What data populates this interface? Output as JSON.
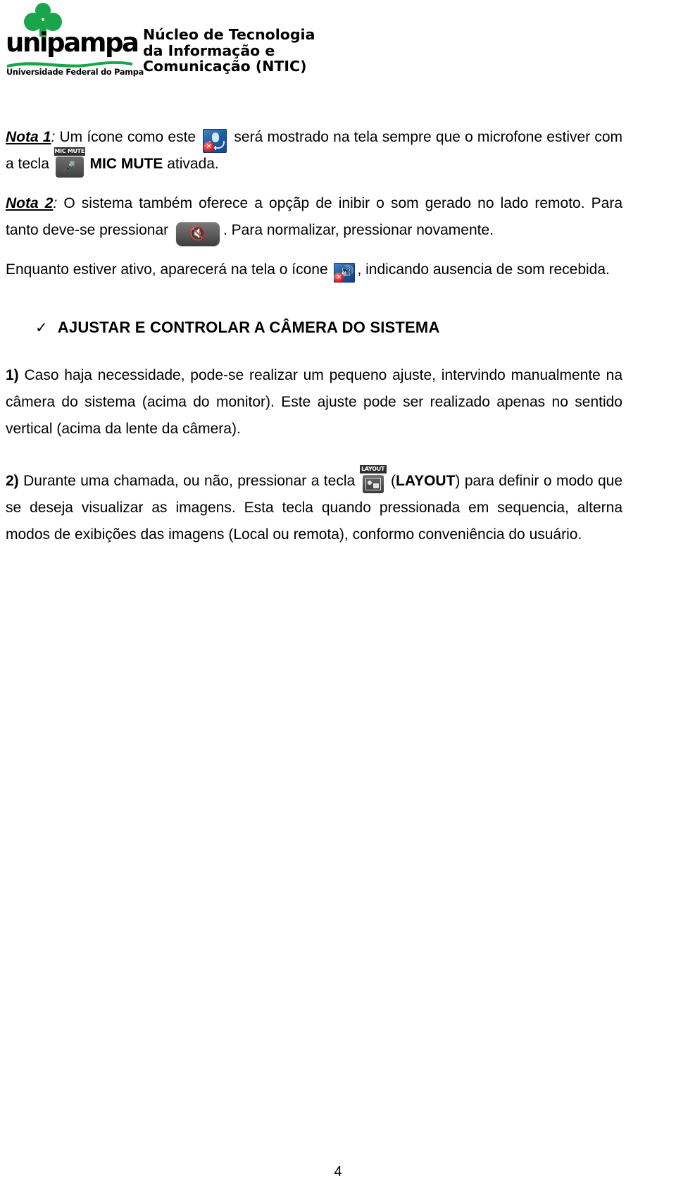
{
  "header": {
    "logo": {
      "wordmark": "unipampa",
      "subtitle": "Universidade Federal do Pampa",
      "green": "#1aa54a"
    },
    "department": {
      "line1": "Núcleo de Tecnologia",
      "line2": "da Informação e",
      "line3": "Comunicação (NTIC)"
    }
  },
  "body": {
    "note1": {
      "label": "Nota 1",
      "colon": ": ",
      "text_a": "Um ícone como este ",
      "text_b": " será mostrado na tela sempre que o microfone estiver com a tecla ",
      "text_c": " MIC MUTE",
      "text_d": " ativada."
    },
    "note2": {
      "label": "Nota 2",
      "colon": ": ",
      "text_a": "O sistema também oferece a opçãp de inibir o som gerado no lado remoto. Para tanto deve-se pressionar ",
      "text_b": ". Para normalizar, pressionar novamente."
    },
    "paragraph_enquanto": {
      "text_a": "Enquanto estiver ativo, aparecerá na tela o ícone ",
      "text_b": ", indicando ausencia de som recebida."
    },
    "section_heading": {
      "check_glyph": "✓",
      "title": "AJUSTAR E CONTROLAR A CÂMERA DO SISTEMA"
    },
    "item1": {
      "number": "1)",
      "text": " Caso haja necessidade, pode-se realizar um pequeno ajuste, intervindo manualmente na câmera do sistema (acima do monitor). Este ajuste pode ser realizado apenas no sentido vertical (acima da lente da câmera)."
    },
    "item2": {
      "number": "2)",
      "text_a": " Durante uma chamada, ou não, pressionar a tecla ",
      "text_b": " (",
      "layout_label": "LAYOUT",
      "text_c": ") para definir o modo que se deseja visualizar as imagens. Esta tecla quando pressionada em sequencia, alterna modos de exibições das imagens (Local ou remota), conformo conveniência do usuário."
    }
  },
  "icons": {
    "mic_mute_indicator": "mic-mute-indicator-icon",
    "mic_mute_key_caption": "MIC MUTE",
    "mic_mute_key_glyph": "🎤",
    "speaker_mute_key_glyph": "🔇",
    "speaker_mute_indicator": "speaker-mute-indicator-icon",
    "speaker_glyph": "🔊",
    "x_badge": "✕",
    "layout_key_caption": "LAYOUT"
  },
  "footer": {
    "page_number": "4"
  }
}
